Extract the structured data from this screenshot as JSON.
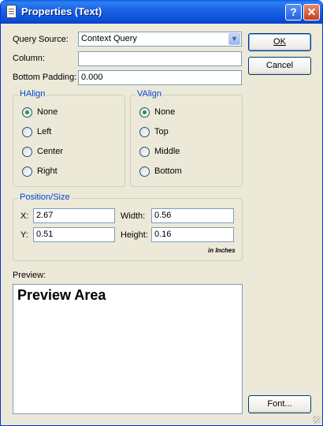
{
  "window": {
    "title": "Properties (Text)",
    "help_glyph": "?",
    "close_glyph": "✕"
  },
  "form": {
    "query_source": {
      "label": "Query Source:",
      "value": "Context Query"
    },
    "column": {
      "label": "Column:",
      "value": ""
    },
    "bottom_padding": {
      "label": "Bottom Padding:",
      "value": "0.000"
    }
  },
  "buttons": {
    "ok": "OK",
    "cancel": "Cancel",
    "font": "Font..."
  },
  "halign": {
    "title": "HAlign",
    "options": [
      "None",
      "Left",
      "Center",
      "Right"
    ],
    "selected": "None"
  },
  "valign": {
    "title": "VAlign",
    "options": [
      "None",
      "Top",
      "Middle",
      "Bottom"
    ],
    "selected": "None"
  },
  "position_size": {
    "title": "Position/Size",
    "x": {
      "label": "X:",
      "value": "2.67"
    },
    "y": {
      "label": "Y:",
      "value": "0.51"
    },
    "width": {
      "label": "Width:",
      "value": "0.56"
    },
    "height": {
      "label": "Height:",
      "value": "0.16"
    },
    "units": "in Inches"
  },
  "preview": {
    "label": "Preview:",
    "text": "Preview Area"
  },
  "colors": {
    "title_bar": "#0a4ed6",
    "group_title": "#0046d5",
    "radio_dot": "#21a121",
    "dialog_bg": "#ece9d8"
  }
}
